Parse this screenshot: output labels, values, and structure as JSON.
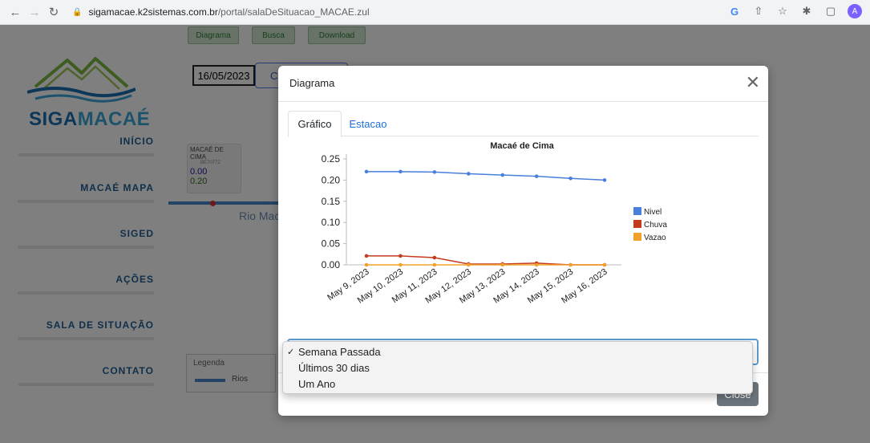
{
  "browser": {
    "url_domain": "sigamacae.k2sistemas.com.br",
    "url_path": "/portal/salaDeSituacao_MACAE.zul",
    "avatar_letter": "A"
  },
  "logo": {
    "part1": "SIGA",
    "part2": "MACAÉ"
  },
  "menu": {
    "items": [
      {
        "label": "INÍCIO"
      },
      {
        "label": "MACAÉ MAPA"
      },
      {
        "label": "SIGED"
      },
      {
        "label": "AÇÕES"
      },
      {
        "label": "SALA DE SITUAÇÃO"
      },
      {
        "label": "CONTATO"
      }
    ]
  },
  "top_tabs": [
    "Diagrama",
    "Busca",
    "Download"
  ],
  "date_input": {
    "value": "16/05/2023"
  },
  "consult_button": {
    "label": "C"
  },
  "station": {
    "name": "MACAÉ DE CIMA",
    "code": "BE70772",
    "value1": "0.00",
    "value2": "0.20"
  },
  "river": {
    "label": "Rio Mac"
  },
  "legend_panel": {
    "title": "Legenda",
    "item": "Rios"
  },
  "modal": {
    "title": "Diagrama",
    "tabs": [
      {
        "label": "Gráfico"
      },
      {
        "label": "Estacao"
      }
    ],
    "close_label": "Close"
  },
  "dropdown": {
    "options": [
      {
        "label": "Semana Passada",
        "selected": true
      },
      {
        "label": "Últimos 30 dias",
        "selected": false
      },
      {
        "label": "Um Ano",
        "selected": false
      }
    ],
    "check_glyph": "✓"
  },
  "colors": {
    "nivel": "#4a7fdc",
    "chuva": "#c43c1c",
    "vazao": "#f2a02c",
    "accent": "#1e6fd9"
  },
  "chart_data": {
    "type": "line",
    "title": "Macaé de Cima",
    "categories": [
      "May 9, 2023",
      "May 10, 2023",
      "May 11, 2023",
      "May 12, 2023",
      "May 13, 2023",
      "May 14, 2023",
      "May 15, 2023",
      "May 16, 2023"
    ],
    "yticks": [
      "0.25",
      "0.20",
      "0.15",
      "0.10",
      "0.05",
      "0.00"
    ],
    "ylim": [
      0,
      0.25
    ],
    "legend_position": "right",
    "series": [
      {
        "name": "Nivel",
        "values": [
          0.22,
          0.22,
          0.219,
          0.215,
          0.212,
          0.209,
          0.204,
          0.2
        ]
      },
      {
        "name": "Chuva",
        "values": [
          0.021,
          0.021,
          0.017,
          0.002,
          0.002,
          0.004,
          0.0,
          0.0
        ]
      },
      {
        "name": "Vazao",
        "values": [
          0,
          0,
          0,
          0,
          0,
          0,
          0,
          0
        ]
      }
    ]
  }
}
